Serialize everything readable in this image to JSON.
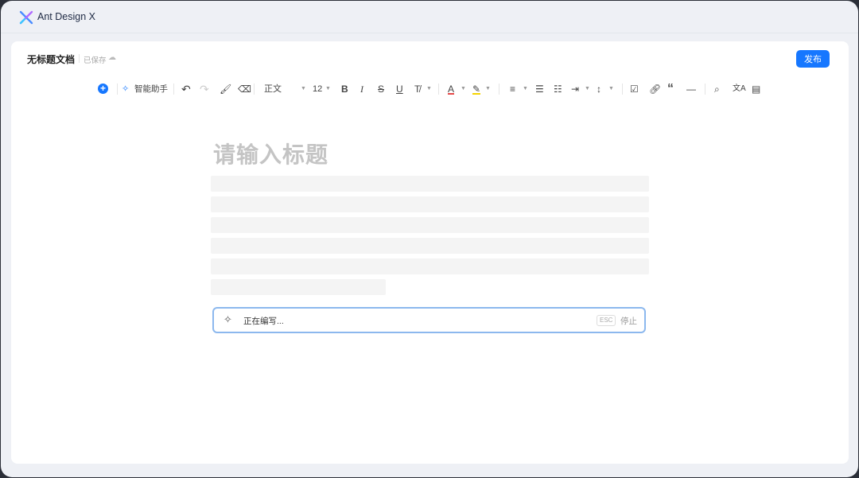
{
  "app": {
    "brand": "Ant Design X"
  },
  "document": {
    "title": "无标题文档",
    "save_status": "已保存",
    "publish_label": "发布",
    "title_placeholder": "请输入标题"
  },
  "toolbar": {
    "ai_label": "智能助手",
    "style_value": "正文",
    "font_size": "12"
  },
  "ai_bar": {
    "status": "正在编写...",
    "esc_key": "ESC",
    "stop_label": "停止"
  },
  "colors": {
    "accent": "#1677ff"
  }
}
